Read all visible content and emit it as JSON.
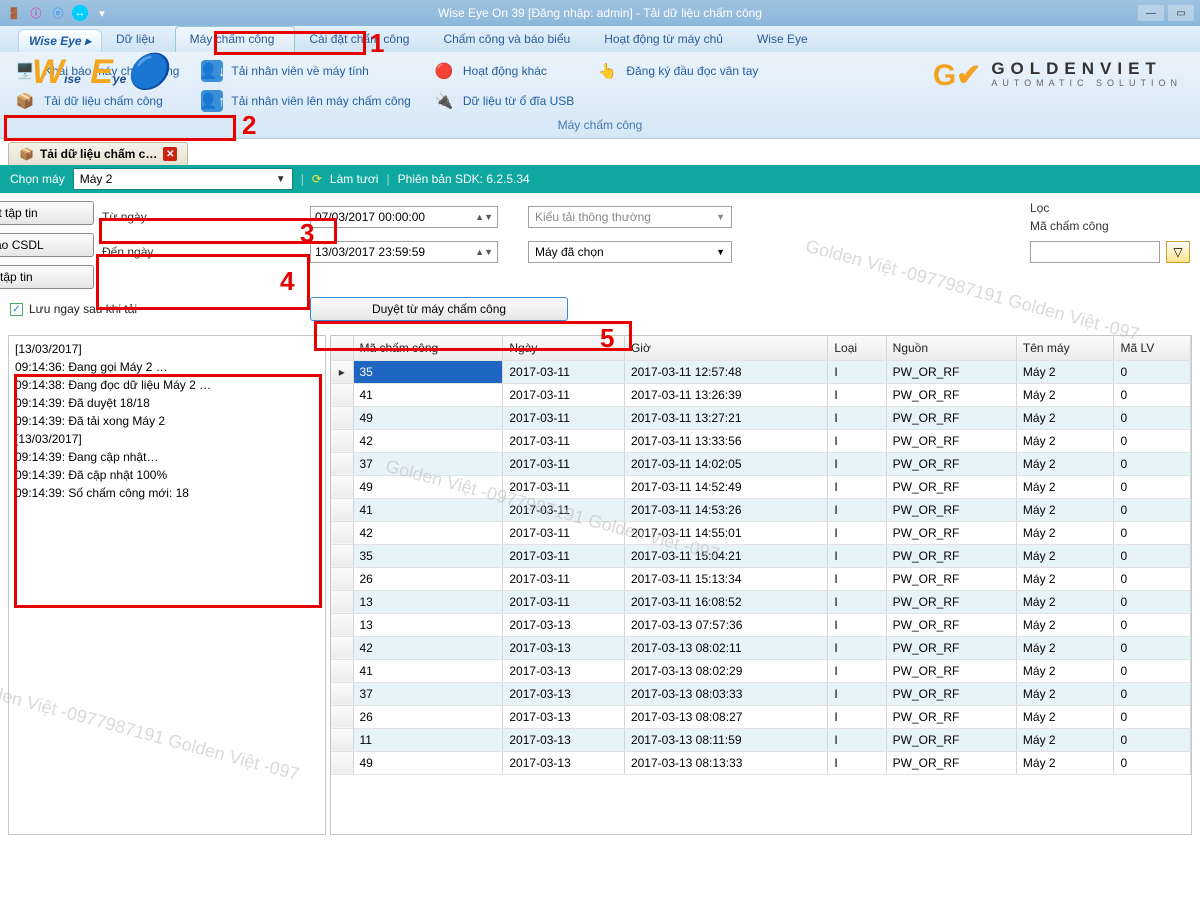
{
  "window": {
    "title": "Wise Eye On 39 [Đăng nhập: admin] - Tải dữ liệu chấm công"
  },
  "menu": {
    "brand": "Wise Eye",
    "items": [
      "Dữ liệu",
      "Máy chấm công",
      "Cài đặt chấm công",
      "Chấm công và báo biểu",
      "Hoạt động từ máy chủ",
      "Wise Eye"
    ]
  },
  "ribbon": {
    "caption": "Máy chấm công",
    "col1": {
      "a": "Khai báo máy chấm công",
      "b": "Tải dữ liệu chấm công"
    },
    "col2": {
      "a": "Tải nhân viên về máy tính",
      "b": "Tải nhân viên lên máy chấm công"
    },
    "col3": {
      "a": "Hoạt động khác",
      "b": "Dữ liệu từ ổ đĩa USB"
    },
    "col4": {
      "a": "Đăng ký đầu đọc vân tay"
    }
  },
  "logo": {
    "big": "GOLDENVIET",
    "small": "AUTOMATIC SOLUTION"
  },
  "doctab": "Tải dữ liệu chấm c…",
  "toolbar": {
    "choose_machine_label": "Chọn máy",
    "machine_value": "Máy 2",
    "refresh": "Làm tươi",
    "sdk": "Phiên bản SDK: 6.2.5.34"
  },
  "filters": {
    "from_label": "Từ ngày",
    "from_value": "07/03/2017 00:00:00",
    "to_label": "Đến ngày",
    "to_value": "13/03/2017 23:59:59",
    "load_type_label": "Kiểu tải thông thường",
    "machine_sel": "Máy đã chọn",
    "browse_machine_btn": "Duyệt từ máy chấm công",
    "save_after_chk": "Lưu ngay sau khi tải",
    "group_label": "Lọc",
    "code_label": "Mã chấm công",
    "btn_browse_file": "Duyệt tập tin",
    "btn_save_db": "Lưu vào CSDL",
    "btn_save_file": "Lưu tập tin"
  },
  "log": "[13/03/2017]\n09:14:36: Đang gọi Máy 2 …\n09:14:38: Đang đọc dữ liệu Máy 2 …\n09:14:39: Đã duyệt 18/18\n09:14:39: Đã tải xong Máy 2\n[13/03/2017]\n09:14:39: Đang cập nhật…\n09:14:39: Đã cập nhật 100%\n09:14:39: Số chấm công mới: 18",
  "table": {
    "headers": [
      "",
      "Mã chấm công",
      "Ngày",
      "Giờ",
      "Loại",
      "Nguồn",
      "Tên máy",
      "Mã LV"
    ],
    "rows": [
      [
        "▸",
        "35",
        "2017-03-11",
        "2017-03-11 12:57:48",
        "I",
        "PW_OR_RF",
        "Máy 2",
        "0"
      ],
      [
        "",
        "41",
        "2017-03-11",
        "2017-03-11 13:26:39",
        "I",
        "PW_OR_RF",
        "Máy 2",
        "0"
      ],
      [
        "",
        "49",
        "2017-03-11",
        "2017-03-11 13:27:21",
        "I",
        "PW_OR_RF",
        "Máy 2",
        "0"
      ],
      [
        "",
        "42",
        "2017-03-11",
        "2017-03-11 13:33:56",
        "I",
        "PW_OR_RF",
        "Máy 2",
        "0"
      ],
      [
        "",
        "37",
        "2017-03-11",
        "2017-03-11 14:02:05",
        "I",
        "PW_OR_RF",
        "Máy 2",
        "0"
      ],
      [
        "",
        "49",
        "2017-03-11",
        "2017-03-11 14:52:49",
        "I",
        "PW_OR_RF",
        "Máy 2",
        "0"
      ],
      [
        "",
        "41",
        "2017-03-11",
        "2017-03-11 14:53:26",
        "I",
        "PW_OR_RF",
        "Máy 2",
        "0"
      ],
      [
        "",
        "42",
        "2017-03-11",
        "2017-03-11 14:55:01",
        "I",
        "PW_OR_RF",
        "Máy 2",
        "0"
      ],
      [
        "",
        "35",
        "2017-03-11",
        "2017-03-11 15:04:21",
        "I",
        "PW_OR_RF",
        "Máy 2",
        "0"
      ],
      [
        "",
        "26",
        "2017-03-11",
        "2017-03-11 15:13:34",
        "I",
        "PW_OR_RF",
        "Máy 2",
        "0"
      ],
      [
        "",
        "13",
        "2017-03-11",
        "2017-03-11 16:08:52",
        "I",
        "PW_OR_RF",
        "Máy 2",
        "0"
      ],
      [
        "",
        "13",
        "2017-03-13",
        "2017-03-13 07:57:36",
        "I",
        "PW_OR_RF",
        "Máy 2",
        "0"
      ],
      [
        "",
        "42",
        "2017-03-13",
        "2017-03-13 08:02:11",
        "I",
        "PW_OR_RF",
        "Máy 2",
        "0"
      ],
      [
        "",
        "41",
        "2017-03-13",
        "2017-03-13 08:02:29",
        "I",
        "PW_OR_RF",
        "Máy 2",
        "0"
      ],
      [
        "",
        "37",
        "2017-03-13",
        "2017-03-13 08:03:33",
        "I",
        "PW_OR_RF",
        "Máy 2",
        "0"
      ],
      [
        "",
        "26",
        "2017-03-13",
        "2017-03-13 08:08:27",
        "I",
        "PW_OR_RF",
        "Máy 2",
        "0"
      ],
      [
        "",
        "11",
        "2017-03-13",
        "2017-03-13 08:11:59",
        "I",
        "PW_OR_RF",
        "Máy 2",
        "0"
      ],
      [
        "",
        "49",
        "2017-03-13",
        "2017-03-13 08:13:33",
        "I",
        "PW_OR_RF",
        "Máy 2",
        "0"
      ]
    ]
  },
  "annotations": {
    "1": "1",
    "2": "2",
    "3": "3",
    "4": "4",
    "5": "5"
  },
  "watermark": "Golden Việt -0977987191 Golden Việt -097"
}
